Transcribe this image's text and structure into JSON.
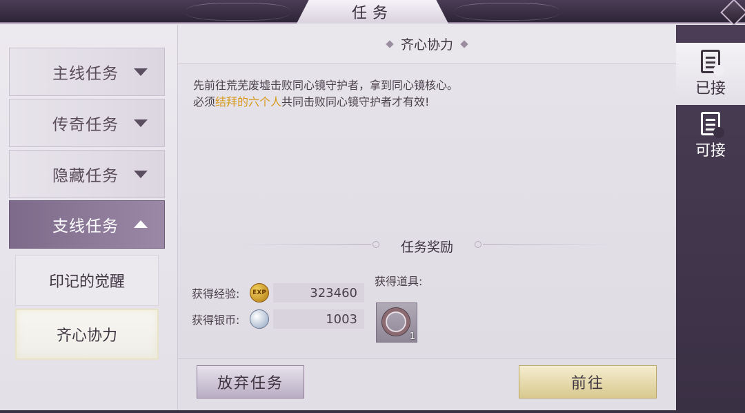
{
  "window": {
    "title": "任务"
  },
  "categories": [
    {
      "label": "主线任务",
      "expanded": false
    },
    {
      "label": "传奇任务",
      "expanded": false
    },
    {
      "label": "隐藏任务",
      "expanded": false
    },
    {
      "label": "支线任务",
      "expanded": true
    }
  ],
  "subquests": [
    {
      "label": "印记的觉醒",
      "selected": false
    },
    {
      "label": "齐心协力",
      "selected": true
    }
  ],
  "quest": {
    "title": "齐心协力",
    "line1": "先前往荒芜废墟击败同心镜守护者，拿到同心镜核心。",
    "line2_before": "必须",
    "line2_highlight": "结拜的六个人",
    "line2_after": "共同击败同心镜守护者才有效!",
    "highlight_color": "#d89a1c"
  },
  "rewards": {
    "title": "任务奖励",
    "exp_label": "获得经验:",
    "exp_icon_text": "EXP",
    "exp_value": "323460",
    "silver_label": "获得银币:",
    "silver_value": "1003",
    "items_label": "获得道具:",
    "item_count": "1",
    "item_icon": "ring-icon"
  },
  "actions": {
    "abandon": "放弃任务",
    "go": "前往"
  },
  "tabs": [
    {
      "label": "已接",
      "icon": "accepted-doc-icon",
      "active": true
    },
    {
      "label": "可接",
      "icon": "available-doc-icon",
      "active": false
    }
  ]
}
